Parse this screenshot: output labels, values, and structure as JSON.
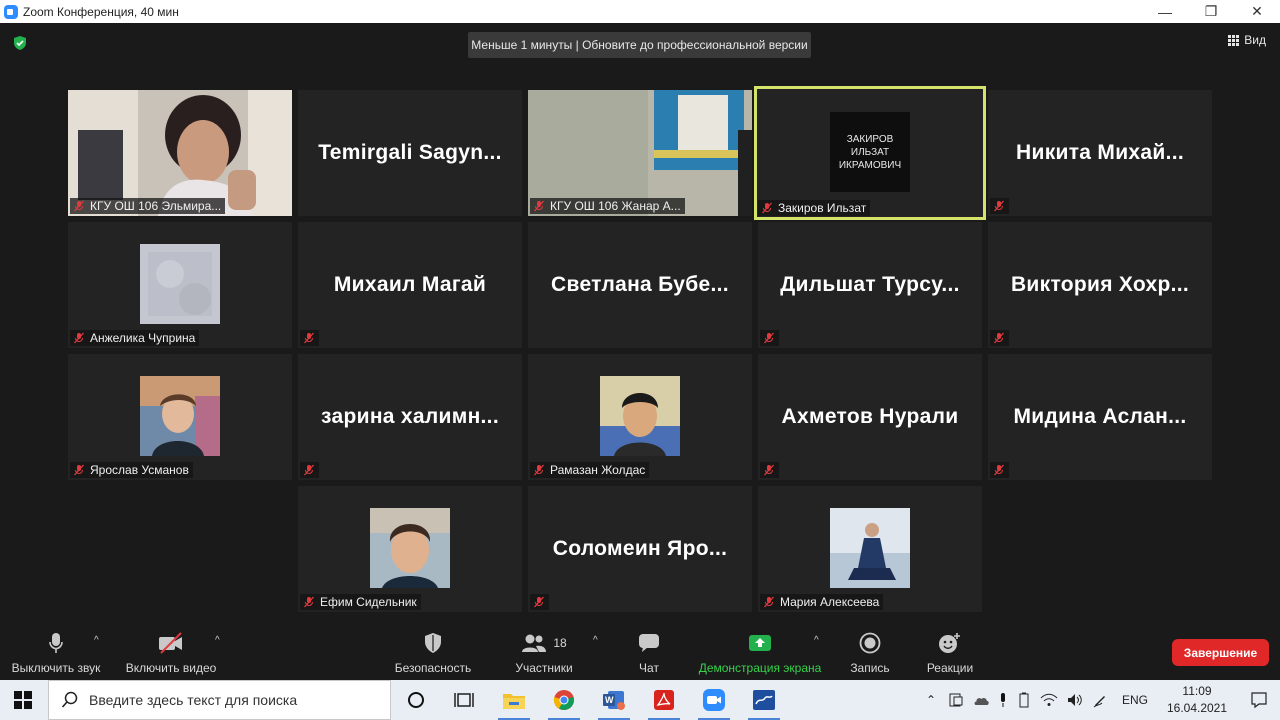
{
  "window": {
    "title": "Zoom Конференция, 40 мин",
    "minimize": "—",
    "maximize": "❐",
    "close": "✕"
  },
  "meeting": {
    "banner": "Меньше 1 минуты | Обновите до профессиональной версии",
    "view_label": "Вид"
  },
  "participants": [
    {
      "name": "КГУ ОШ 106 Эльмира...",
      "video": true
    },
    {
      "name": "Temirgali  Sagyn...",
      "video": false
    },
    {
      "name": "КГУ ОШ 106 Жанар А...",
      "video": true
    },
    {
      "name": "Закиров Ильзат",
      "avatar_text": "ЗАКИРОВ ИЛЬЗАТ ИКРАМОВИЧ",
      "active": true
    },
    {
      "name": "Никита  Михай...",
      "video": false
    },
    {
      "name": "Анжелика Чуприна",
      "avatar": true
    },
    {
      "name": "Михаил Магай",
      "video": false
    },
    {
      "name": "Светлана  Бубе...",
      "video": false
    },
    {
      "name": "Дильшат  Турсу...",
      "video": false
    },
    {
      "name": "Виктория  Хохр...",
      "video": false
    },
    {
      "name": "Ярослав Усманов",
      "avatar": true
    },
    {
      "name": "зарина  халимн...",
      "video": false
    },
    {
      "name": "Рамазан Жолдас",
      "avatar": true
    },
    {
      "name": "Ахметов Нурали",
      "video": false
    },
    {
      "name": "Мидина  Аслан...",
      "video": false
    },
    {
      "name": "Ефим Сидельник",
      "avatar": true
    },
    {
      "name": "Соломеин  Яро...",
      "video": false
    },
    {
      "name": "Мария Алексеева",
      "avatar": true
    }
  ],
  "toolbar": {
    "mute": "Выключить звук",
    "video": "Включить видео",
    "security": "Безопасность",
    "participants": "Участники",
    "participants_count": "18",
    "chat": "Чат",
    "share": "Демонстрация экрана",
    "record": "Запись",
    "reactions": "Реакции",
    "end": "Завершение",
    "caret": "^"
  },
  "taskbar": {
    "search_placeholder": "Введите здесь текст для поиска",
    "lang": "ENG",
    "time": "11:09",
    "date": "16.04.2021"
  },
  "colors": {
    "active_border": "#d6e36a",
    "share_green": "#35d24a",
    "end_red": "#e02828",
    "mute_red": "#e0393e"
  }
}
